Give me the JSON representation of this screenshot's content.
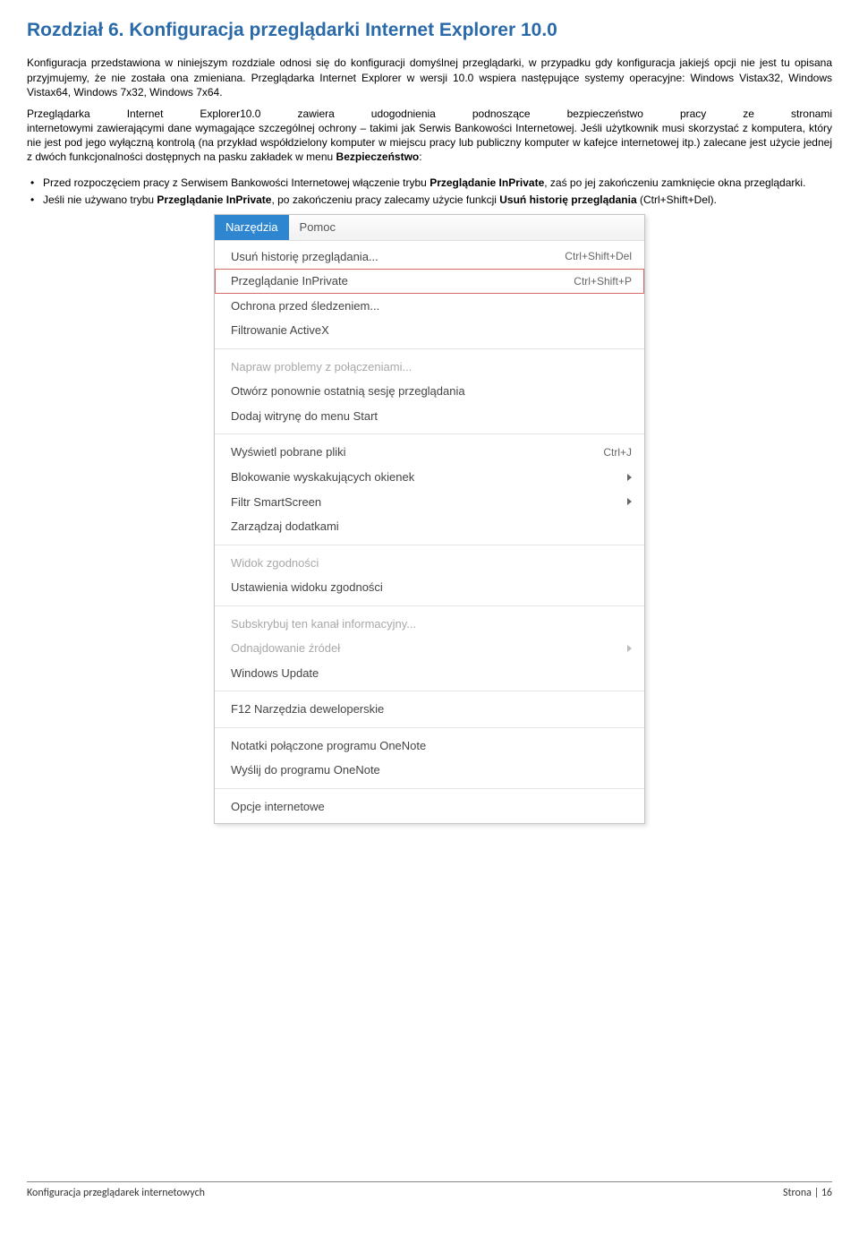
{
  "heading": "Rozdział 6.  Konfiguracja przeglądarki Internet Explorer 10.0",
  "para1": "Konfiguracja przedstawiona w niniejszym rozdziale odnosi się do konfiguracji domyślnej przeglądarki, w przypadku gdy konfiguracja jakiejś opcji nie jest tu opisana przyjmujemy, że nie została ona zmieniana. Przeglądarka Internet Explorer w wersji 10.0 wspiera następujące systemy operacyjne: Windows Vistax32, Windows Vistax64, Windows 7x32, Windows 7x64.",
  "para2_lead": "Przeglądarka Internet Explorer10.0 zawiera udogodnienia podnoszące bezpieczeństwo pracy ze stronami",
  "para2_rest_a": "internetowymi zawierającymi dane wymagające szczególnej ochrony – takimi jak Serwis Bankowości Internetowej. Jeśli użytkownik musi skorzystać z komputera, który nie jest pod jego wyłączną kontrolą (na przykład współdzielony komputer w miejscu pracy lub publiczny komputer w kafejce internetowej itp.) zalecane jest użycie jednej z dwóch funkcjonalności dostępnych na pasku zakładek w menu ",
  "para2_rest_b": "Bezpieczeństwo",
  "para2_rest_c": ":",
  "bullet1_a": "Przed rozpoczęciem pracy z Serwisem Bankowości Internetowej włączenie trybu ",
  "bullet1_b": "Przeglądanie InPrivate",
  "bullet1_c": ", zaś po jej zakończeniu zamknięcie okna przeglądarki.",
  "bullet2_a": "Jeśli nie używano trybu ",
  "bullet2_b": "Przeglądanie InPrivate",
  "bullet2_c": ", po zakończeniu pracy zalecamy użycie funkcji ",
  "bullet2_d": "Usuń historię przeglądania",
  "bullet2_e": " (Ctrl+Shift+Del).",
  "menubar": {
    "active": "Narzędzia",
    "inactive": "Pomoc"
  },
  "menu": {
    "g1": [
      {
        "label": "Usuń historię przeglądania...",
        "shortcut": "Ctrl+Shift+Del"
      },
      {
        "label": "Przeglądanie InPrivate",
        "shortcut": "Ctrl+Shift+P",
        "hl": true
      },
      {
        "label": "Ochrona przed śledzeniem...",
        "shortcut": ""
      },
      {
        "label": "Filtrowanie ActiveX",
        "shortcut": ""
      }
    ],
    "g2": [
      {
        "label": "Napraw problemy z połączeniami...",
        "shortcut": "",
        "disabled": true
      },
      {
        "label": "Otwórz ponownie ostatnią sesję przeglądania",
        "shortcut": ""
      },
      {
        "label": "Dodaj witrynę do menu Start",
        "shortcut": ""
      }
    ],
    "g3": [
      {
        "label": "Wyświetl pobrane pliki",
        "shortcut": "Ctrl+J"
      },
      {
        "label": "Blokowanie wyskakujących okienek",
        "submenu": true
      },
      {
        "label": "Filtr SmartScreen",
        "submenu": true
      },
      {
        "label": "Zarządzaj dodatkami",
        "shortcut": ""
      }
    ],
    "g4": [
      {
        "label": "Widok zgodności",
        "shortcut": "",
        "disabled": true
      },
      {
        "label": "Ustawienia widoku zgodności",
        "shortcut": ""
      }
    ],
    "g5": [
      {
        "label": "Subskrybuj ten kanał informacyjny...",
        "shortcut": "",
        "disabled": true
      },
      {
        "label": "Odnajdowanie źródeł",
        "submenu": true,
        "disabled": true
      },
      {
        "label": "Windows Update",
        "shortcut": ""
      }
    ],
    "g6": [
      {
        "label": "F12 Narzędzia deweloperskie",
        "shortcut": ""
      }
    ],
    "g7": [
      {
        "label": "Notatki połączone programu OneNote",
        "shortcut": ""
      },
      {
        "label": "Wyślij do programu OneNote",
        "shortcut": ""
      }
    ],
    "g8": [
      {
        "label": "Opcje internetowe",
        "shortcut": ""
      }
    ]
  },
  "footer": {
    "left": "Konfiguracja przeglądarek internetowych",
    "right": "Strona | 16"
  }
}
